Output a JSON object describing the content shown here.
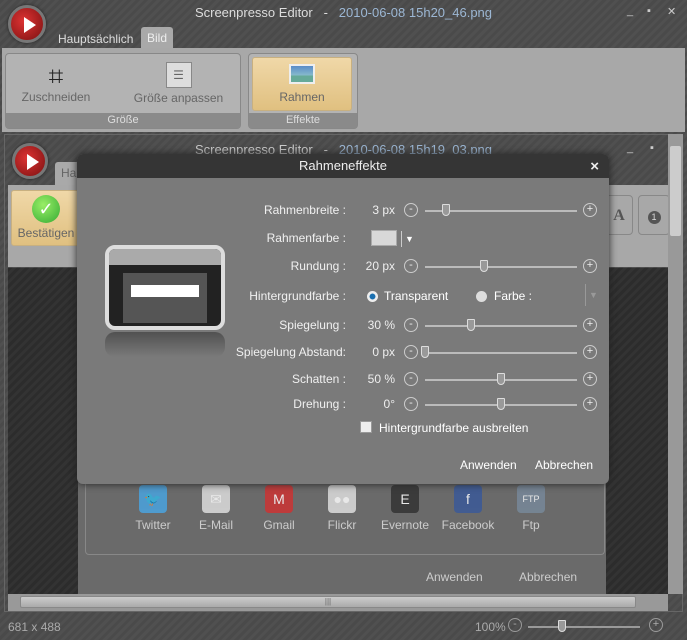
{
  "outer": {
    "app_title": "Screenpresso Editor",
    "separator": "-",
    "file": "2010-06-08 15h20_46.png",
    "tabs": [
      "Hauptsächlich",
      "Bild"
    ],
    "groups": [
      {
        "label": "Größe",
        "buttons": [
          "Zuschneiden",
          "Größe anpassen"
        ]
      },
      {
        "label": "Effekte",
        "buttons": [
          "Rahmen"
        ]
      }
    ]
  },
  "inner": {
    "app_title": "Screenpresso Editor",
    "separator": "-",
    "file": "2010-06-08 15h19_03.png",
    "tab": "Ha",
    "confirm": "Bestätigen",
    "text_tool": "A",
    "number_tool": "1"
  },
  "dialog": {
    "title": "Rahmeneffekte",
    "close": "×",
    "rows": [
      {
        "label": "Rahmenbreite :",
        "value": "3 px",
        "slider": 0.14
      },
      {
        "label": "Rahmenfarbe :",
        "color": "#d8d8d8"
      },
      {
        "label": "Rundung :",
        "value": "20 px",
        "slider": 0.39
      },
      {
        "label": "Hintergrundfarbe :",
        "options": [
          "Transparent",
          "Farbe :"
        ],
        "selected": "Transparent"
      },
      {
        "label": "Spiegelung :",
        "value": "30 %",
        "slider": 0.3
      },
      {
        "label": "Spiegelung Abstand:",
        "value": "0 px",
        "slider": 0
      },
      {
        "label": "Schatten :",
        "value": "50 %",
        "slider": 0.5
      },
      {
        "label": "Drehung :",
        "value": "0°",
        "slider": 0.5
      }
    ],
    "checkbox": {
      "label": "Hintergrundfarbe ausbreiten",
      "checked": false
    },
    "apply": "Anwenden",
    "cancel": "Abbrechen"
  },
  "background_dialog": {
    "share": [
      "Twitter",
      "E-Mail",
      "Gmail",
      "Flickr",
      "Evernote",
      "Facebook",
      "Ftp"
    ],
    "apply": "Anwenden",
    "cancel": "Abbrechen"
  },
  "status": {
    "dimensions": "681 x 488",
    "zoom": "100%",
    "zoom_slider": 0.3
  },
  "colors": {
    "accent_selected": "#e8c890",
    "dialog_title": "#353535"
  }
}
